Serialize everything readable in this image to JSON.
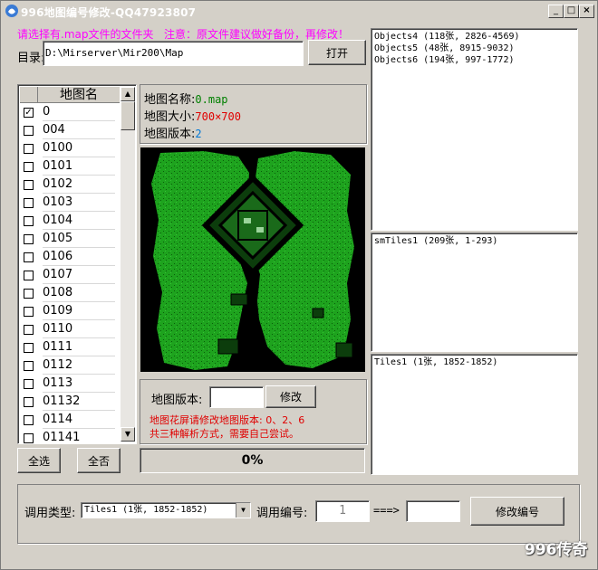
{
  "window": {
    "title": "996地图编号修改-QQ47923807"
  },
  "colors": {
    "hint": "#ff00ff",
    "map_name": "#008000",
    "map_size": "#e00000",
    "map_version": "#0078d7",
    "warning": "#e00000",
    "map_ground": "#1ea31e"
  },
  "hints": {
    "select_folder": "请选择有.map文件的文件夹",
    "note": "注意：原文件建议做好备份，再修改！"
  },
  "directory": {
    "label": "目录:",
    "value": "D:\\Mirserver\\Mir200\\Map",
    "open_button": "打开"
  },
  "map_list": {
    "header": "地图名",
    "items": [
      {
        "name": "0",
        "checked": true
      },
      {
        "name": "004",
        "checked": false
      },
      {
        "name": "0100",
        "checked": false
      },
      {
        "name": "0101",
        "checked": false
      },
      {
        "name": "0102",
        "checked": false
      },
      {
        "name": "0103",
        "checked": false
      },
      {
        "name": "0104",
        "checked": false
      },
      {
        "name": "0105",
        "checked": false
      },
      {
        "name": "0106",
        "checked": false
      },
      {
        "name": "0107",
        "checked": false
      },
      {
        "name": "0108",
        "checked": false
      },
      {
        "name": "0109",
        "checked": false
      },
      {
        "name": "0110",
        "checked": false
      },
      {
        "name": "0111",
        "checked": false
      },
      {
        "name": "0112",
        "checked": false
      },
      {
        "name": "0113",
        "checked": false
      },
      {
        "name": "01132",
        "checked": false
      },
      {
        "name": "0114",
        "checked": false
      },
      {
        "name": "01141",
        "checked": false
      }
    ],
    "select_all": "全选",
    "select_none": "全否"
  },
  "map_info": {
    "name_label": "地图名称:",
    "name_value": "0.map",
    "size_label": "地图大小:",
    "size_value": "700×700",
    "version_label": "地图版本:",
    "version_value": "2"
  },
  "version_edit": {
    "label": "地图版本:",
    "value": "",
    "button": "修改",
    "warning_line1": "地图花屏请修改地图版本: 0、2、6",
    "warning_line2": "共三种解析方式，需要自己尝试。"
  },
  "progress": {
    "text": "0%",
    "value": 0
  },
  "panels": {
    "objects": [
      "Objects4  (118张, 2826-4569)",
      "Objects5  (48张, 8915-9032)",
      "Objects6  (194张, 997-1772)"
    ],
    "smtiles": [
      "smTiles1  (209张, 1-293)"
    ],
    "tiles": [
      "Tiles1  (1张, 1852-1852)"
    ]
  },
  "bottom": {
    "type_label": "调用类型:",
    "type_value": "Tiles1  (1张, 1852-1852)",
    "number_label": "调用编号:",
    "number_value": "1",
    "arrow": "===>",
    "target_value": "",
    "modify_button": "修改编号"
  },
  "watermark": "996传奇"
}
